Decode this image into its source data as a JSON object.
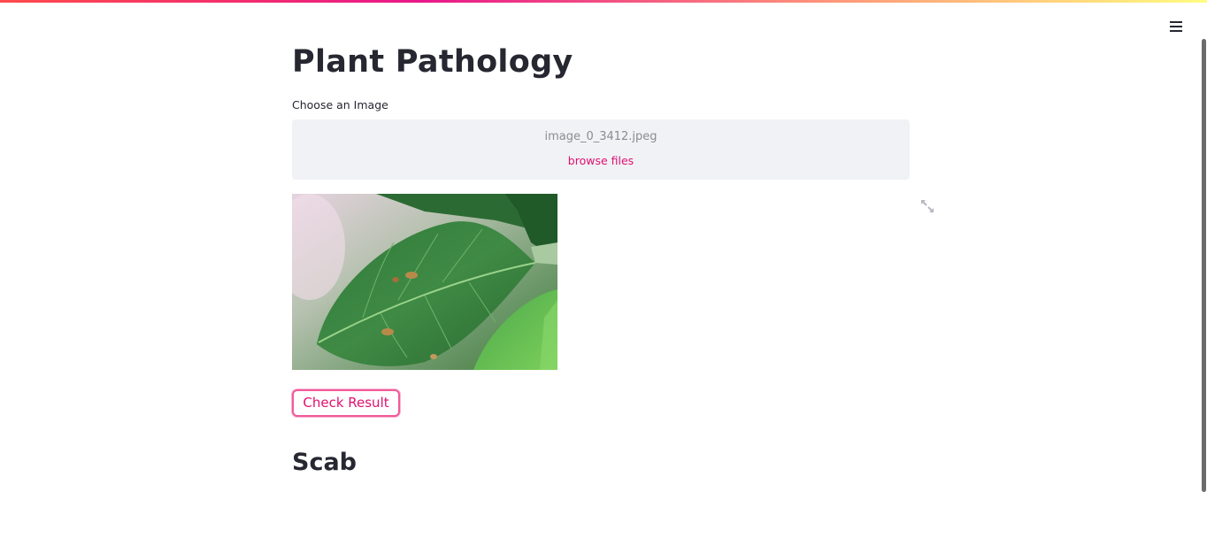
{
  "app": {
    "title": "Plant Pathology"
  },
  "uploader": {
    "label": "Choose an Image",
    "file_name": "image_0_3412.jpeg",
    "browse_label": "browse files"
  },
  "image": {
    "subject": "apple leaf with scab lesions"
  },
  "actions": {
    "check_label": "Check Result"
  },
  "result": {
    "label": "Scab"
  },
  "icons": {
    "menu": "hamburger-menu-icon",
    "fullscreen": "fullscreen-expand-icon"
  },
  "colors": {
    "accent": "#e0106f",
    "text": "#262730",
    "dropzone_bg": "#f0f2f6"
  }
}
